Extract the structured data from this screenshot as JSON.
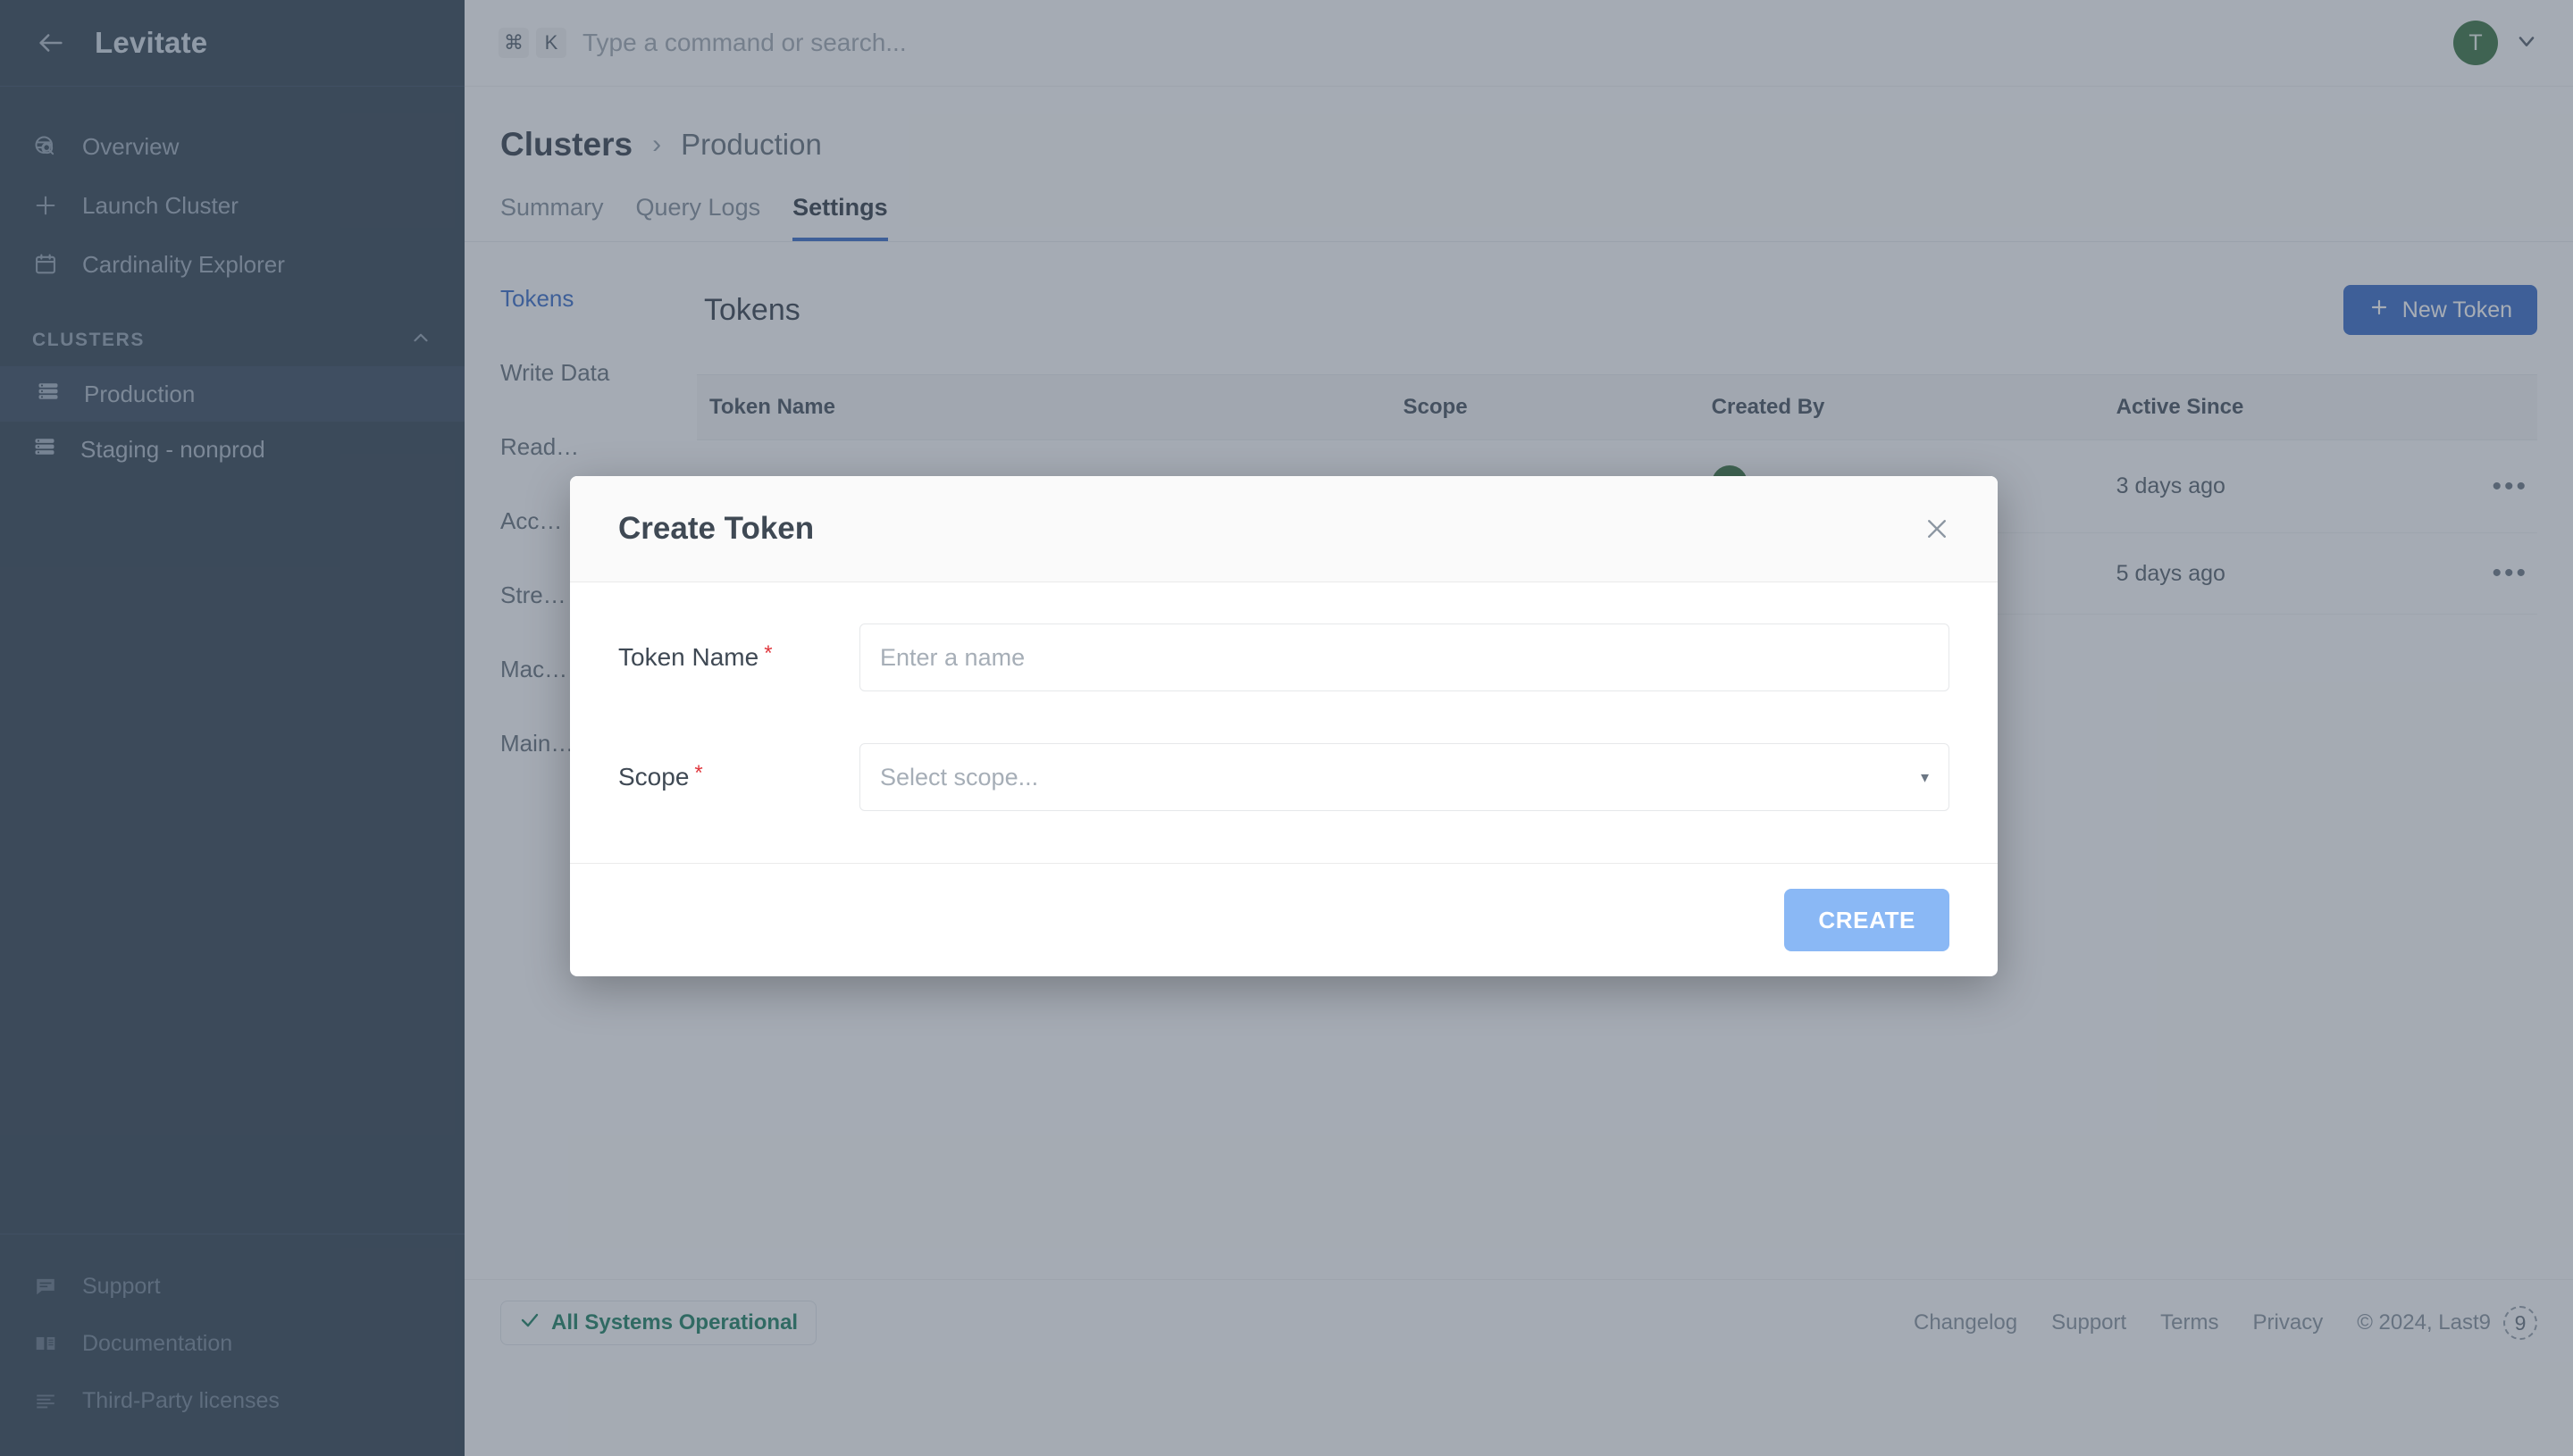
{
  "sidebar": {
    "brand": "Levitate",
    "back_icon": "arrow-left-icon",
    "nav": [
      {
        "label": "Overview",
        "icon": "globe-search-icon"
      },
      {
        "label": "Launch Cluster",
        "icon": "plus-icon"
      },
      {
        "label": "Cardinality Explorer",
        "icon": "calendar-icon"
      }
    ],
    "section": {
      "label": "CLUSTERS",
      "chevron": "chevron-up-icon"
    },
    "clusters": [
      {
        "label": "Production",
        "icon": "server-icon",
        "active": true
      },
      {
        "label": "Staging - nonprod",
        "icon": "server-icon",
        "active": false
      }
    ],
    "bottom": [
      {
        "label": "Support",
        "icon": "chat-icon"
      },
      {
        "label": "Documentation",
        "icon": "book-icon"
      },
      {
        "label": "Third-Party licenses",
        "icon": "list-icon"
      }
    ]
  },
  "topbar": {
    "kbd": [
      "⌘",
      "K"
    ],
    "search_placeholder": "Type a command or search...",
    "search_value": "",
    "avatar_initial": "T",
    "avatar_color": "#2f6b38",
    "chevron": "chevron-down-icon"
  },
  "breadcrumb": {
    "root": "Clusters",
    "separator": "›",
    "current": "Production"
  },
  "tabs": [
    {
      "label": "Summary",
      "active": false
    },
    {
      "label": "Query Logs",
      "active": false
    },
    {
      "label": "Settings",
      "active": true
    }
  ],
  "settings_nav": [
    {
      "label": "Tokens",
      "active": true
    },
    {
      "label": "Write Data",
      "active": false
    },
    {
      "label": "Read…",
      "active": false
    },
    {
      "label": "Acc…",
      "active": false
    },
    {
      "label": "Stre…",
      "active": false
    },
    {
      "label": "Mac…",
      "active": false
    },
    {
      "label": "Main…",
      "active": false
    }
  ],
  "tokens": {
    "title": "Tokens",
    "new_button": "New Token",
    "new_button_icon": "plus-icon",
    "columns": [
      "Token Name",
      "Scope",
      "Created By",
      "Active Since",
      ""
    ],
    "rows": [
      {
        "name": "",
        "scope": "",
        "created_by": "",
        "active_since": "3 days ago",
        "menu": "•••"
      },
      {
        "name": "",
        "scope": "",
        "created_by": "",
        "active_since": "5 days ago",
        "menu": "•••"
      }
    ]
  },
  "modal": {
    "title": "Create Token",
    "close_icon": "close-icon",
    "fields": [
      {
        "label": "Token Name",
        "required": "*",
        "placeholder": "Enter a name",
        "value": ""
      },
      {
        "label": "Scope",
        "required": "*",
        "placeholder": "Select scope...",
        "value": "",
        "caret": "▾"
      }
    ],
    "submit_label": "CREATE",
    "submit_color": "#8ab8f5"
  },
  "footer": {
    "status": {
      "icon": "check-icon",
      "label": "All Systems Operational",
      "color": "#10795a"
    },
    "links": [
      "Changelog",
      "Support",
      "Terms",
      "Privacy"
    ],
    "copyright": "© 2024, Last9",
    "badge": "9"
  },
  "theme": {
    "sidebar_bg": "#273849",
    "accent": "#2c62c4",
    "overlay": "rgba(80,92,107,0.50)"
  }
}
